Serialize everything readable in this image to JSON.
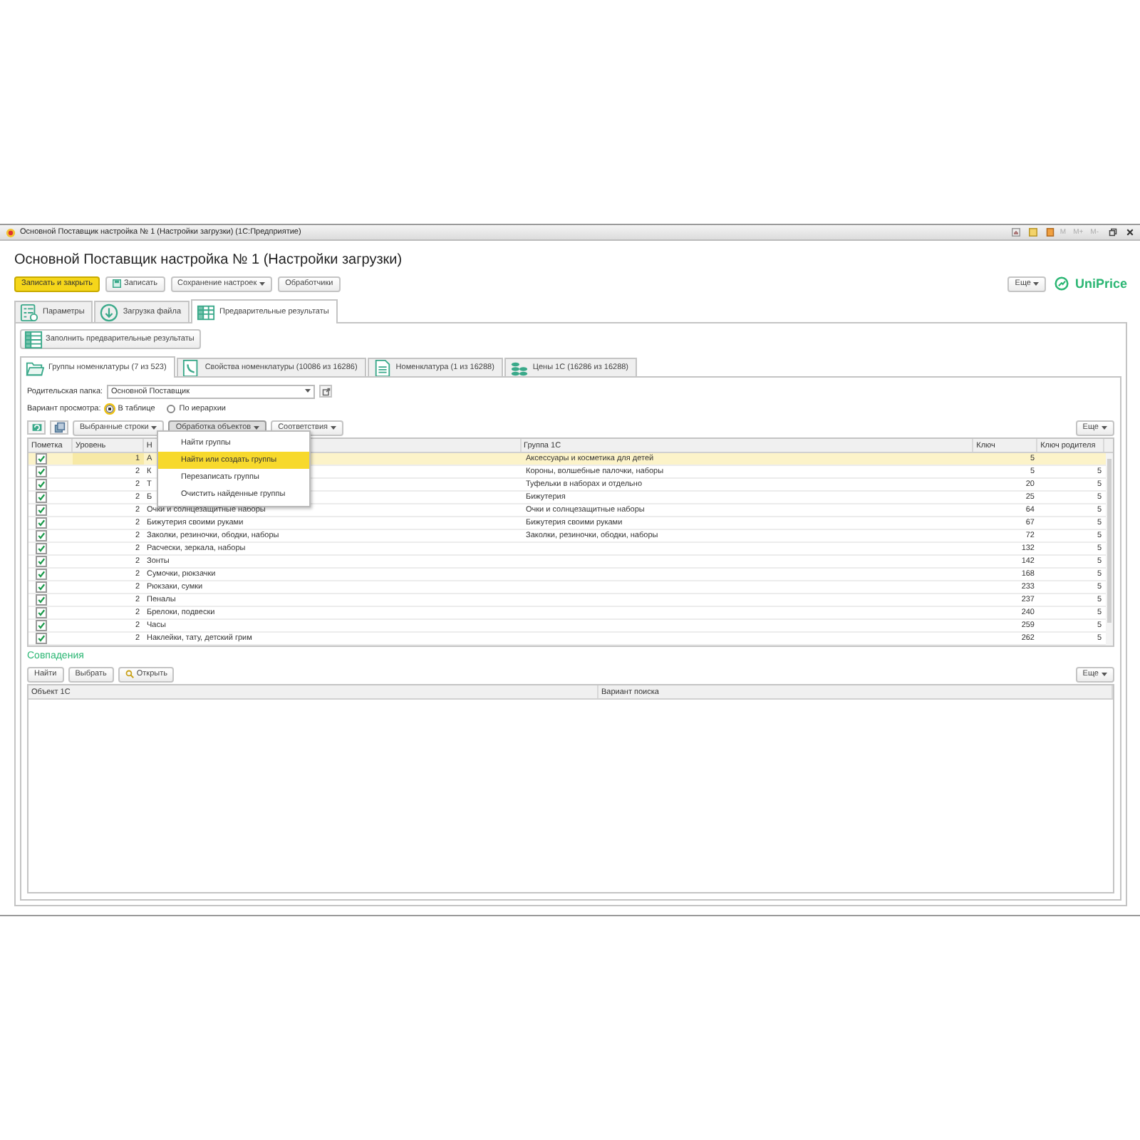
{
  "window": {
    "title": "Основной Поставщик настройка № 1 (Настройки загрузки)  (1С:Предприятие)",
    "memory_buttons": [
      "M",
      "M+",
      "M-"
    ]
  },
  "form": {
    "heading": "Основной Поставщик настройка № 1 (Настройки загрузки)",
    "toolbar": [
      {
        "label": "Записать и закрыть",
        "kind": "primary"
      },
      {
        "label": "Записать",
        "kind": "icon"
      },
      {
        "label": "Сохранение настроек",
        "kind": "dropdown"
      },
      {
        "label": "Обработчики",
        "kind": "plain"
      }
    ],
    "more_button": "Еще",
    "logo": "UniPrice"
  },
  "tabs": [
    {
      "label": "Параметры",
      "selected": false
    },
    {
      "label": "Загрузка файла",
      "selected": false
    },
    {
      "label": "Предварительные результаты",
      "selected": true
    }
  ],
  "fill_button": "Заполнить предварительные результаты",
  "inner_tabs": [
    {
      "label": "Группы номенклатуры (7 из 523)",
      "selected": true
    },
    {
      "label": "Свойства номенклатуры (10086 из 16286)",
      "selected": false
    },
    {
      "label": "Номенклатура (1 из 16288)",
      "selected": false
    },
    {
      "label": "Цены 1С (16286 из 16288)",
      "selected": false
    }
  ],
  "parent_folder": {
    "label": "Родительская папка:",
    "value": "Основной Поставщик"
  },
  "view_variant": {
    "label": "Вариант просмотра:",
    "options": [
      {
        "label": "В таблице",
        "selected": true
      },
      {
        "label": "По иерархии",
        "selected": false
      }
    ]
  },
  "table_toolbar": {
    "dropdowns": [
      {
        "label": "Выбранные строки",
        "selected": false
      },
      {
        "label": "Обработка объектов",
        "selected": true
      },
      {
        "label": "Соответствия",
        "selected": false
      }
    ],
    "more_button": "Еще"
  },
  "table": {
    "columns": [
      "Пометка",
      "Уровень",
      "Н",
      "Группа 1С",
      "Ключ",
      "Ключ родителя"
    ],
    "rows": [
      {
        "checked": true,
        "selected": true,
        "level": "1",
        "name": "А",
        "group": "Аксессуары и косметика для детей",
        "key": "5",
        "parent_key": ""
      },
      {
        "checked": true,
        "selected": false,
        "level": "2",
        "name": "К",
        "group": "Короны, волшебные палочки, наборы",
        "key": "5",
        "parent_key": "5"
      },
      {
        "checked": true,
        "selected": false,
        "level": "2",
        "name": "Т",
        "group": "Туфельки в наборах и отдельно",
        "key": "20",
        "parent_key": "5"
      },
      {
        "checked": true,
        "selected": false,
        "level": "2",
        "name": "Б",
        "group": "Бижутерия",
        "key": "25",
        "parent_key": "5"
      },
      {
        "checked": true,
        "selected": false,
        "level": "2",
        "name": "Очки и солнцезащитные наборы",
        "group": "Очки и солнцезащитные наборы",
        "key": "64",
        "parent_key": "5"
      },
      {
        "checked": true,
        "selected": false,
        "level": "2",
        "name": "Бижутерия своими руками",
        "group": "Бижутерия своими руками",
        "key": "67",
        "parent_key": "5"
      },
      {
        "checked": true,
        "selected": false,
        "level": "2",
        "name": "Заколки, резиночки, ободки, наборы",
        "group": "Заколки, резиночки, ободки, наборы",
        "key": "72",
        "parent_key": "5"
      },
      {
        "checked": true,
        "selected": false,
        "level": "2",
        "name": "Расчески, зеркала, наборы",
        "group": "",
        "key": "132",
        "parent_key": "5"
      },
      {
        "checked": true,
        "selected": false,
        "level": "2",
        "name": "Зонты",
        "group": "",
        "key": "142",
        "parent_key": "5"
      },
      {
        "checked": true,
        "selected": false,
        "level": "2",
        "name": "Сумочки, рюкзачки",
        "group": "",
        "key": "168",
        "parent_key": "5"
      },
      {
        "checked": true,
        "selected": false,
        "level": "2",
        "name": "Рюкзаки, сумки",
        "group": "",
        "key": "233",
        "parent_key": "5"
      },
      {
        "checked": true,
        "selected": false,
        "level": "2",
        "name": "Пеналы",
        "group": "",
        "key": "237",
        "parent_key": "5"
      },
      {
        "checked": true,
        "selected": false,
        "level": "2",
        "name": "Брелоки, подвески",
        "group": "",
        "key": "240",
        "parent_key": "5"
      },
      {
        "checked": true,
        "selected": false,
        "level": "2",
        "name": "Часы",
        "group": "",
        "key": "259",
        "parent_key": "5"
      },
      {
        "checked": true,
        "selected": false,
        "level": "2",
        "name": "Наклейки, тату, детский грим",
        "group": "",
        "key": "262",
        "parent_key": "5"
      }
    ]
  },
  "dropdown_menu": {
    "items": [
      {
        "label": "Найти группы",
        "selected": false
      },
      {
        "label": "Найти или создать группы",
        "selected": true
      },
      {
        "label": "Перезаписать группы",
        "selected": false
      },
      {
        "label": "Очистить найденные группы",
        "selected": false
      }
    ]
  },
  "matches": {
    "title": "Совпадения",
    "buttons": [
      {
        "label": "Найти",
        "kind": "plain"
      },
      {
        "label": "Выбрать",
        "kind": "plain"
      },
      {
        "label": "Открыть",
        "kind": "search"
      }
    ],
    "more_button": "Еще",
    "columns": [
      "Объект 1С",
      "Вариант поиска"
    ]
  }
}
